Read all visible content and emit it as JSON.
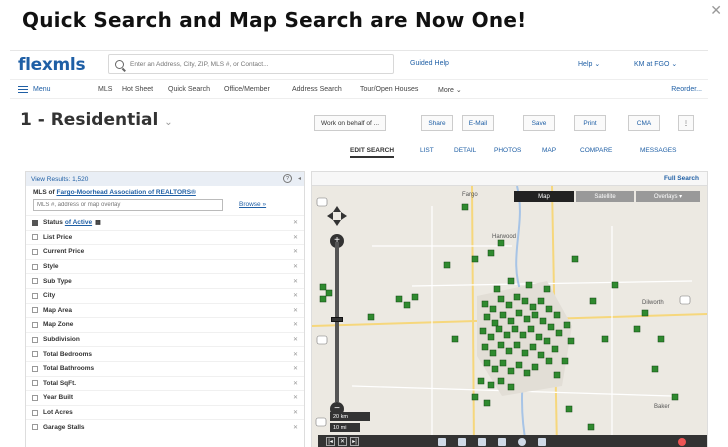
{
  "headline": "Quick Search and Map Search are Now One!",
  "topbar": {
    "logo": "flexmls",
    "search_placeholder": "Enter an Address, City, ZIP, MLS #, or Contact...",
    "guided_help": "Guided Help",
    "help": "Help ⌄",
    "user": "KM at FGO ⌄"
  },
  "nav": {
    "menu": "Menu",
    "items": [
      "MLS",
      "Hot Sheet",
      "Quick Search",
      "Office/Member",
      "Address Search",
      "Tour/Open Houses",
      "More ⌄"
    ],
    "reorder": "Reorder..."
  },
  "title": "1 - Residential",
  "actions": {
    "work_on_behalf": "Work on behalf of ...",
    "share": "Share",
    "email": "E-Mail",
    "save": "Save",
    "print": "Print",
    "cma": "CMA",
    "more": "⋮"
  },
  "tabs": [
    "EDIT SEARCH",
    "LIST",
    "DETAIL",
    "PHOTOS",
    "MAP",
    "COMPARE",
    "MESSAGES"
  ],
  "left_panel": {
    "view_results": "View Results: 1,520",
    "mls_of": "MLS of",
    "mls_link": "Fargo-Moorhead Association of REALTORS®",
    "overlay_placeholder": "MLS #, address or map overlay",
    "browse": "Browse »",
    "criteria": [
      {
        "label": "Status",
        "checked": true,
        "sub": "of Active"
      },
      {
        "label": "List Price"
      },
      {
        "label": "Current Price"
      },
      {
        "label": "Style"
      },
      {
        "label": "Sub Type"
      },
      {
        "label": "City"
      },
      {
        "label": "Map Area"
      },
      {
        "label": "Map Zone"
      },
      {
        "label": "Subdivision"
      },
      {
        "label": "Total Bedrooms"
      },
      {
        "label": "Total Bathrooms"
      },
      {
        "label": "Total SqFt."
      },
      {
        "label": "Year Built"
      },
      {
        "label": "Lot Acres"
      },
      {
        "label": "Garage Stalls"
      }
    ]
  },
  "map": {
    "full_search": "Full Search",
    "btn_map": "Map",
    "btn_satellite": "Satellite",
    "btn_overlays": "Overlays ▾",
    "scale_km": "20 km",
    "scale_mi": "10 mi",
    "labels": [
      "Fargo",
      "Harwood",
      "Dilworth",
      "Baker"
    ]
  }
}
